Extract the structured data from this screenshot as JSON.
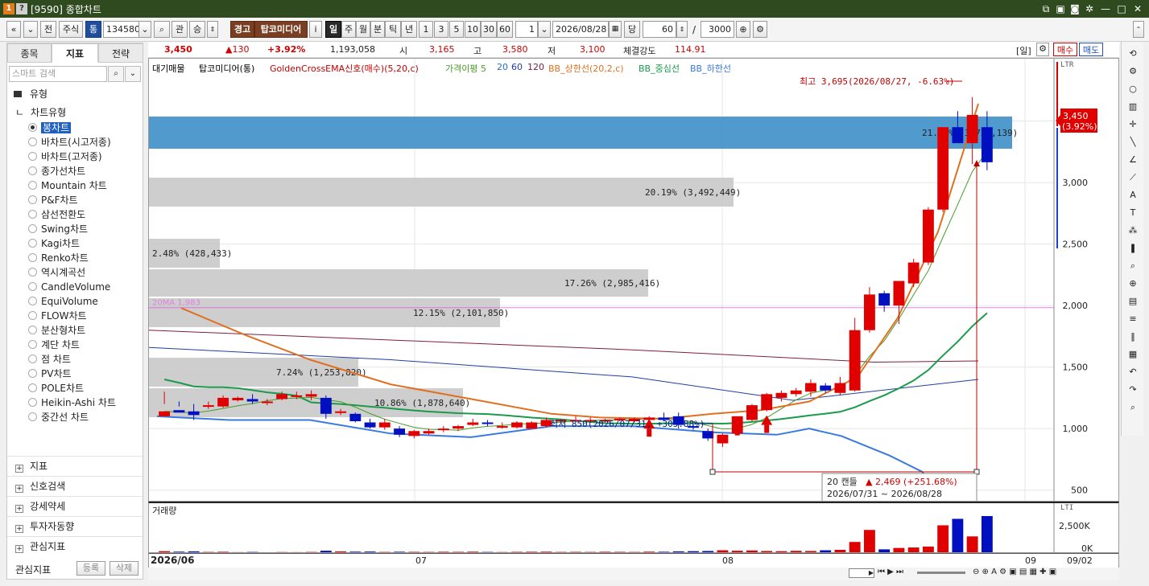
{
  "titlebar": {
    "badge1": "1",
    "badge2": "?",
    "title": "[9590] 종합차트"
  },
  "toolbar": {
    "stock_type": "주식",
    "stock_badge": "통",
    "code": "134580",
    "b_search": "⌕",
    "b_gwan": "관",
    "b_seung": "승",
    "b_jeon": "전",
    "warning": "경고",
    "stock_name": "탑코미디어",
    "info": "i",
    "periods": [
      "일",
      "주",
      "월",
      "분",
      "틱",
      "년"
    ],
    "minutes": [
      "1",
      "3",
      "5",
      "10",
      "30",
      "60"
    ],
    "period_count": "1",
    "date": "2026/08/28",
    "dang": "당",
    "view_count": "60",
    "slash": "/",
    "total_count": "3000"
  },
  "quote": {
    "price": "3,450",
    "change": "▲130",
    "change_pct": "+3.92%",
    "volume": "1,193,058",
    "open_label": "시",
    "open": "3,165",
    "high_label": "고",
    "high": "3,580",
    "low_label": "저",
    "low": "3,100",
    "strength_label": "체결강도",
    "strength": "114.91",
    "il": "[일]",
    "buy": "매수",
    "sell": "매도"
  },
  "left": {
    "tabs": [
      "종목",
      "지표",
      "전략"
    ],
    "search_placeholder": "스마트 검색",
    "type_header": "유형",
    "chart_type_header": "차트유형",
    "chart_types": [
      "봉차트",
      "바차트(시고저종)",
      "바차트(고저종)",
      "종가선차트",
      "Mountain 차트",
      "P&F차트",
      "삼선전환도",
      "Swing차트",
      "Kagi차트",
      "Renko차트",
      "역시계곡선",
      "CandleVolume",
      "EquiVolume",
      "FLOW차트",
      "분산형차트",
      "계단 차트",
      "점 차트",
      "PV차트",
      "POLE차트",
      "Heikin-Ashi 차트",
      "중간선 차트"
    ],
    "sections": [
      "지표",
      "신호검색",
      "강세약세",
      "투자자동향",
      "관심지표"
    ],
    "footer_label": "관심지표",
    "footer_btn1": "등록",
    "footer_btn2": "삭제"
  },
  "legend": {
    "items": [
      {
        "text": "대기매물",
        "color": "#000000"
      },
      {
        "text": "탑코미디어(통)",
        "color": "#000000"
      },
      {
        "text": "GoldenCrossEMA신호(매수)(5,20,c)",
        "color": "#c00000"
      },
      {
        "text": "가격이평 5",
        "color": "#4a9a2a"
      },
      {
        "text": "20",
        "color": "#1f6fd0"
      },
      {
        "text": "60",
        "color": "#1f3fa0"
      },
      {
        "text": "120",
        "color": "#7a2040"
      },
      {
        "text": "BB_상한선(20,2,c)",
        "color": "#e07020"
      },
      {
        "text": "BB_중심선",
        "color": "#1a9a4a"
      },
      {
        "text": "BB_하한선",
        "color": "#3a7ae0"
      }
    ]
  },
  "annotations": {
    "high": "최고 3,695(2026/08/27, -6.63%)",
    "low": "최저 850(2026/07/31, +305.88%)",
    "range_candles": "20 캔들",
    "range_change": "▲ 2,469 (+251.68%)",
    "range_dates": "2026/07/31 ~ 2026/08/28",
    "pink_line": "20MA 1,983",
    "price_tag": "3,450",
    "price_tag_pct": "(3.92%)",
    "vol_title": "거래량",
    "ltr": "LTR",
    "lti": "LTI"
  },
  "volume_profile": [
    {
      "label": "21.31% (3,725,139)"
    },
    {
      "label": "20.19% (3,492,449)"
    },
    {
      "label": "2.48% (428,433)"
    },
    {
      "label": "17.26% (2,985,416)"
    },
    {
      "label": "12.15% (2,101,850)"
    },
    {
      "label": "7.24% (1,253,820)"
    },
    {
      "label": "10.86% (1,878,640)"
    }
  ],
  "chart_data": {
    "type": "candlestick",
    "ylim": [
      400,
      3850
    ],
    "y_ticks": [
      "3,500",
      "3,000",
      "2,500",
      "2,000",
      "1,500",
      "1,000",
      "500"
    ],
    "x_ticks": [
      "2026/06",
      "07",
      "08",
      "09",
      "09/02"
    ],
    "candles": [
      [
        1100,
        1300,
        1200,
        1140
      ],
      [
        1150,
        1220,
        1180,
        1130
      ],
      [
        1140,
        1200,
        1070,
        1110
      ],
      [
        1180,
        1220,
        1160,
        1190
      ],
      [
        1180,
        1270,
        1170,
        1250
      ],
      [
        1230,
        1260,
        1220,
        1250
      ],
      [
        1240,
        1280,
        1200,
        1220
      ],
      [
        1210,
        1240,
        1190,
        1220
      ],
      [
        1240,
        1300,
        1230,
        1280
      ],
      [
        1260,
        1300,
        1240,
        1270
      ],
      [
        1260,
        1310,
        1230,
        1280
      ],
      [
        1250,
        1270,
        1080,
        1120
      ],
      [
        1130,
        1160,
        1110,
        1140
      ],
      [
        1120,
        1130,
        1050,
        1060
      ],
      [
        1050,
        1080,
        1000,
        1010
      ],
      [
        1010,
        1080,
        990,
        1050
      ],
      [
        1000,
        1020,
        930,
        950
      ],
      [
        940,
        990,
        920,
        980
      ],
      [
        960,
        1000,
        950,
        980
      ],
      [
        990,
        1020,
        970,
        1000
      ],
      [
        1000,
        1030,
        980,
        1020
      ],
      [
        1030,
        1080,
        1020,
        1050
      ],
      [
        1050,
        1070,
        1020,
        1040
      ],
      [
        1020,
        1050,
        1000,
        1020
      ],
      [
        1010,
        1060,
        1000,
        1050
      ],
      [
        1000,
        1060,
        1000,
        1050
      ],
      [
        1020,
        1090,
        1010,
        1070
      ],
      [
        1060,
        1080,
        1050,
        1070
      ],
      [
        1060,
        1100,
        1050,
        1070
      ],
      [
        1060,
        1090,
        1050,
        1070
      ],
      [
        1060,
        1080,
        1050,
        1070
      ],
      [
        1070,
        1090,
        1060,
        1080
      ],
      [
        1060,
        1090,
        1050,
        1080
      ],
      [
        1070,
        1100,
        1060,
        1090
      ],
      [
        1090,
        1130,
        1060,
        1070
      ],
      [
        1100,
        1130,
        1000,
        1030
      ],
      [
        1020,
        1040,
        990,
        1010
      ],
      [
        980,
        1000,
        900,
        920
      ],
      [
        880,
        960,
        850,
        950
      ],
      [
        960,
        1100,
        950,
        1100
      ],
      [
        1070,
        1200,
        1060,
        1190
      ],
      [
        1150,
        1290,
        1140,
        1280
      ],
      [
        1250,
        1310,
        1220,
        1290
      ],
      [
        1280,
        1330,
        1260,
        1310
      ],
      [
        1300,
        1400,
        1260,
        1370
      ],
      [
        1350,
        1370,
        1290,
        1310
      ],
      [
        1290,
        1420,
        1270,
        1370
      ],
      [
        1310,
        1900,
        1300,
        1800
      ],
      [
        1800,
        2150,
        1780,
        2090
      ],
      [
        2100,
        2120,
        1950,
        2000
      ],
      [
        2000,
        2150,
        1850,
        2200
      ],
      [
        2180,
        2380,
        2150,
        2350
      ],
      [
        2350,
        2800,
        2330,
        2780
      ],
      [
        2780,
        3450,
        2760,
        3450
      ],
      [
        3450,
        3580,
        3350,
        3320
      ],
      [
        3320,
        3695,
        3150,
        3550
      ],
      [
        3450,
        3580,
        3100,
        3165
      ]
    ],
    "volumes": [
      20,
      15,
      18,
      12,
      14,
      10,
      12,
      9,
      11,
      10,
      12,
      25,
      18,
      15,
      16,
      12,
      14,
      13,
      12,
      14,
      13,
      15,
      12,
      11,
      13,
      14,
      15,
      12,
      13,
      12,
      14,
      13,
      12,
      15,
      14,
      18,
      20,
      22,
      30,
      25,
      28,
      22,
      20,
      24,
      22,
      30,
      35,
      120,
      250,
      40,
      55,
      60,
      70,
      300,
      370,
      180,
      400,
      270
    ]
  }
}
